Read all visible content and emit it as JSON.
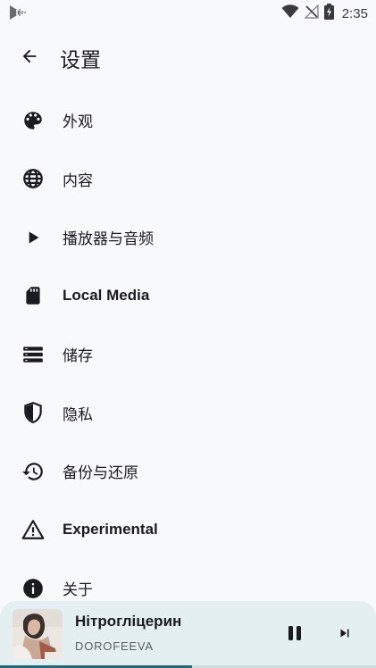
{
  "status_bar": {
    "time": "2:35",
    "icons": [
      "app-notification-icon",
      "wifi-icon",
      "no-signal-icon",
      "battery-charging-icon"
    ]
  },
  "appbar": {
    "back_icon": "arrow-back-icon",
    "title": "设置"
  },
  "settings": {
    "items": [
      {
        "label": "外观",
        "icon": "palette-icon"
      },
      {
        "label": "内容",
        "icon": "globe-icon"
      },
      {
        "label": "播放器与音频",
        "icon": "play-icon"
      },
      {
        "label": "Local Media",
        "icon": "sd-card-icon"
      },
      {
        "label": "储存",
        "icon": "storage-icon"
      },
      {
        "label": "隐私",
        "icon": "shield-icon"
      },
      {
        "label": "备份与还原",
        "icon": "restore-icon"
      },
      {
        "label": "Experimental",
        "icon": "warning-icon"
      },
      {
        "label": "关于",
        "icon": "info-icon"
      }
    ]
  },
  "mini_player": {
    "title": "Нітрогліцерин",
    "artist": "DOROFEEVA",
    "progress": 0.51,
    "pause_icon": "pause-icon",
    "next_icon": "skip-next-icon"
  },
  "colors": {
    "background": "#f8f9fb",
    "player_background": "#e3eff0",
    "progress": "#1e6c7a",
    "icon": "#1b1b1f"
  }
}
